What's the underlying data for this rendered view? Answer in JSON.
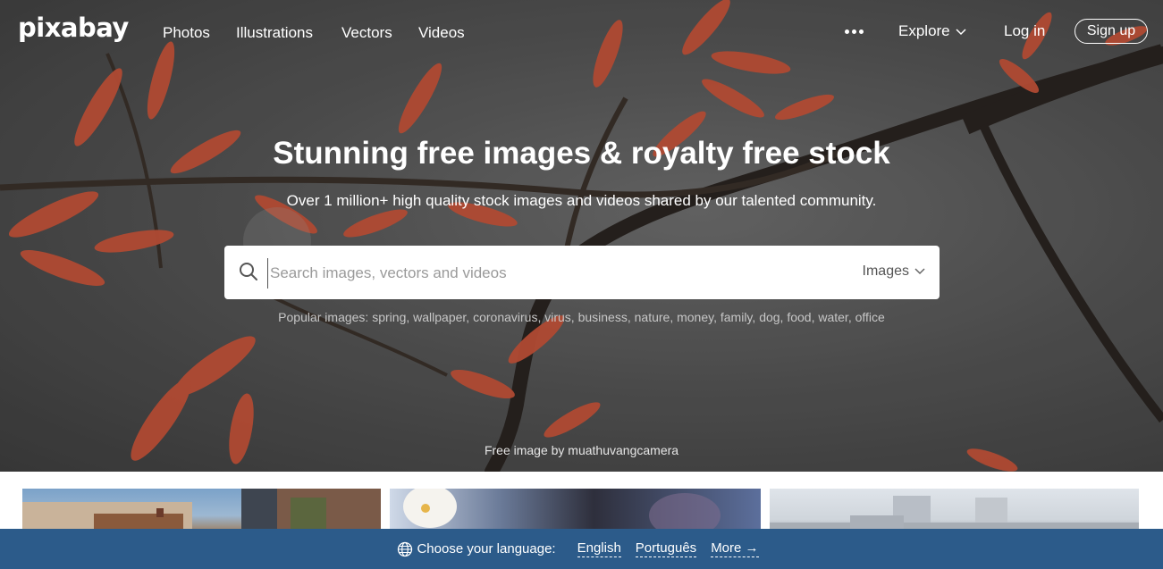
{
  "nav": {
    "logo": "pixabay",
    "links": [
      "Photos",
      "Illustrations",
      "Vectors",
      "Videos"
    ],
    "more_icon": "ellipsis-icon",
    "explore_label": "Explore",
    "login_label": "Log in",
    "signup_label": "Sign up"
  },
  "hero": {
    "title": "Stunning free images & royalty free stock",
    "subtitle": "Over 1 million+ high quality stock images and videos shared by our talented community.",
    "credit": "Free image by muathuvangcamera"
  },
  "search": {
    "placeholder": "Search images, vectors and videos",
    "value": "",
    "type_selected": "Images",
    "icon": "search-icon"
  },
  "popular": {
    "label": "Popular images:",
    "terms": [
      "spring",
      "wallpaper",
      "coronavirus",
      "virus",
      "business",
      "nature",
      "money",
      "family",
      "dog",
      "food",
      "water",
      "office"
    ]
  },
  "language_bar": {
    "label": "Choose your language:",
    "languages": [
      "English",
      "Português",
      "More →"
    ],
    "icon": "globe-icon"
  },
  "colors": {
    "language_bar_bg": "#2c5b8a",
    "foliage": "#c9553a"
  }
}
